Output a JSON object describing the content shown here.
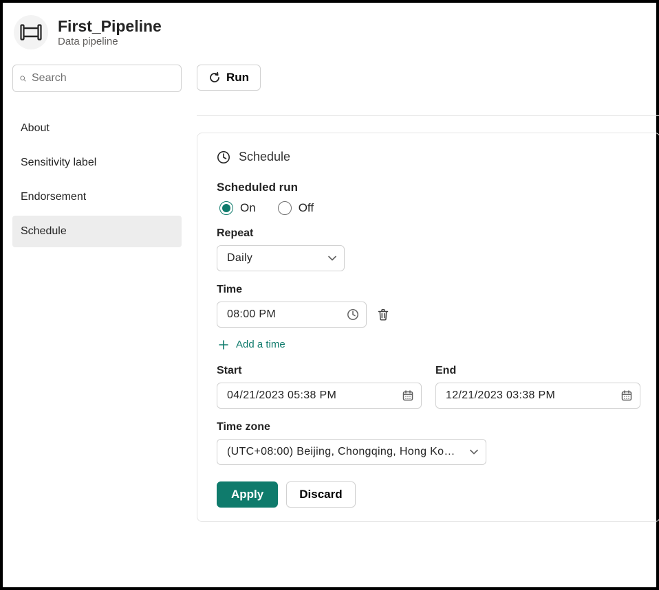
{
  "header": {
    "title": "First_Pipeline",
    "subtitle": "Data pipeline"
  },
  "search": {
    "placeholder": "Search"
  },
  "nav": {
    "items": [
      {
        "label": "About"
      },
      {
        "label": "Sensitivity label"
      },
      {
        "label": "Endorsement"
      },
      {
        "label": "Schedule"
      }
    ],
    "active_index": 3
  },
  "toolbar": {
    "run_label": "Run"
  },
  "schedule_panel": {
    "heading": "Schedule",
    "scheduled_run_label": "Scheduled run",
    "radio_on_label": "On",
    "radio_off_label": "Off",
    "radio_selected": "on",
    "repeat_label": "Repeat",
    "repeat_value": "Daily",
    "time_label": "Time",
    "time_value": "08:00 PM",
    "add_time_label": "Add a time",
    "start_label": "Start",
    "start_value": "04/21/2023 05:38 PM",
    "end_label": "End",
    "end_value": "12/21/2023 03:38 PM",
    "timezone_label": "Time zone",
    "timezone_value": "(UTC+08:00) Beijing, Chongqing, Hong Kon…",
    "apply_label": "Apply",
    "discard_label": "Discard"
  },
  "colors": {
    "accent": "#0f7b6c"
  }
}
